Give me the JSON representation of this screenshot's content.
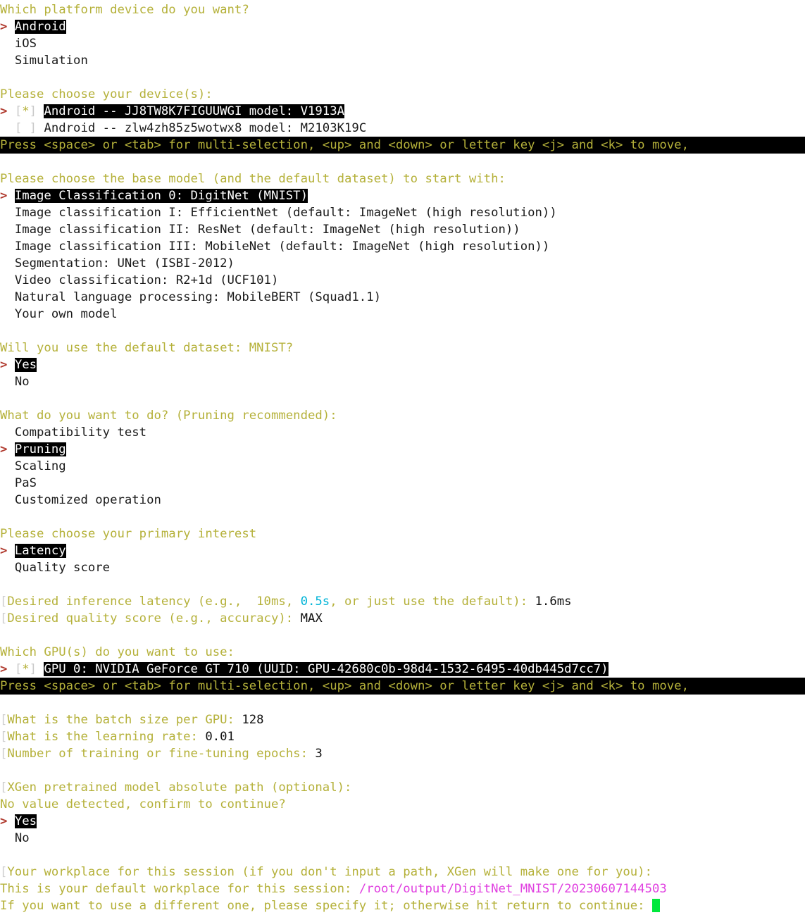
{
  "meta": {
    "app": "XGen CLI setup wizard",
    "pointer": ">",
    "checkbox_checked": "[*]",
    "checkbox_unchecked": "[ ]",
    "edge_bracket": "[",
    "colors": {
      "question": "#b5b13a",
      "pointer": "#b03a2e",
      "selected_bg": "#000000",
      "selected_fg": "#ffffff",
      "plain": "#1a1a1a",
      "cyan_value": "#00b4d8",
      "path_magenta": "#e040e0",
      "cursor_green": "#00e83c",
      "bracket_gray": "#c9c9c9",
      "background": "#ffffff"
    }
  },
  "multiselect_hint": "Press <space> or <tab> for multi-selection, <up> and <down> or letter key <j> and <k> to move,",
  "platform": {
    "question": "Which platform device do you want?",
    "options": [
      "Android",
      "iOS",
      "Simulation"
    ],
    "selected": "Android"
  },
  "devices": {
    "question": "Please choose your device(s):",
    "items": [
      {
        "checked": true,
        "label": "Android -- JJ8TW8K7FIGUUWGI model: V1913A",
        "cursor": true
      },
      {
        "checked": false,
        "label": "Android -- zlw4zh85z5wotwx8 model: M2103K19C",
        "cursor": false
      }
    ]
  },
  "base_model": {
    "question": "Please choose the base model (and the default dataset) to start with:",
    "options": [
      "Image Classification 0: DigitNet (MNIST)",
      "Image classification I: EfficientNet (default: ImageNet (high resolution))",
      "Image classification II: ResNet (default: ImageNet (high resolution))",
      "Image classification III: MobileNet (default: ImageNet (high resolution))",
      "Segmentation: UNet (ISBI-2012)",
      "Video classification: R2+1d (UCF101)",
      "Natural language processing: MobileBERT (Squad1.1)",
      "Your own model"
    ],
    "selected": "Image Classification 0: DigitNet (MNIST)"
  },
  "default_dataset": {
    "question": "Will you use the default dataset: MNIST?",
    "options": [
      "Yes",
      "No"
    ],
    "selected": "Yes"
  },
  "task": {
    "question": "What do you want to do? (Pruning recommended):",
    "options": [
      "Compatibility test",
      "Pruning",
      "Scaling",
      "PaS",
      "Customized operation"
    ],
    "selected": "Pruning"
  },
  "primary_interest": {
    "question": "Please choose your primary interest",
    "options": [
      "Latency",
      "Quality score"
    ],
    "selected": "Latency"
  },
  "latency": {
    "prompt_a": "Desired inference latency (e.g.,  10ms, ",
    "prompt_cyan": "0.5s",
    "prompt_b": ", or just use the default): ",
    "value": "1.6ms"
  },
  "quality": {
    "prompt": "Desired quality score (e.g., accuracy): ",
    "value": "MAX"
  },
  "gpus": {
    "question": "Which GPU(s) do you want to use:",
    "items": [
      {
        "checked": true,
        "label": "GPU 0: NVIDIA GeForce GT 710 (UUID: GPU-42680c0b-98d4-1532-6495-40db445d7cc7)",
        "cursor": true
      }
    ]
  },
  "batch_size": {
    "prompt": "What is the batch size per GPU: ",
    "value": "128"
  },
  "learning_rate": {
    "prompt": "What is the learning rate: ",
    "value": "0.01"
  },
  "epochs": {
    "prompt": "Number of training or fine-tuning epochs: ",
    "value": "3"
  },
  "pretrained": {
    "prompt": "XGen pretrained model absolute path (optional):",
    "confirm_question": "No value detected, confirm to continue?",
    "options": [
      "Yes",
      "No"
    ],
    "selected": "Yes"
  },
  "workplace": {
    "prompt": "Your workplace for this session (if you don't input a path, XGen will make one for you):",
    "default_label": "This is your default workplace for this session: ",
    "default_path": "/root/output/DigitNet_MNIST/20230607144503",
    "continue_label": "If you want to use a different one, please specify it; otherwise hit return to continue: ",
    "input_value": ""
  }
}
